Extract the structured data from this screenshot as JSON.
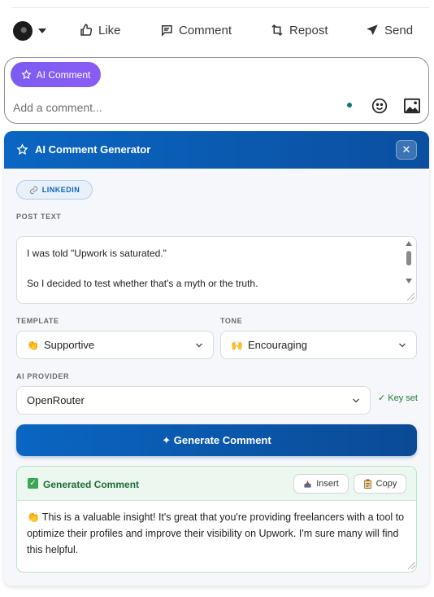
{
  "actions": {
    "like": "Like",
    "comment": "Comment",
    "repost": "Repost",
    "send": "Send"
  },
  "comment_box": {
    "ai_button": "AI Comment",
    "placeholder": "Add a comment..."
  },
  "panel": {
    "title": "AI Comment Generator",
    "close": "✕",
    "platform": "LINKEDIN",
    "post_text_label": "POST TEXT",
    "post_text_lines": [
      "I was told \"Upwork is saturated.\"",
      "So I decided to test whether that's a myth or the truth."
    ],
    "template_label": "TEMPLATE",
    "template_emoji": "👏",
    "template_value": "Supportive",
    "tone_label": "TONE",
    "tone_emoji": "🙌",
    "tone_value": "Encouraging",
    "provider_label": "AI PROVIDER",
    "provider_value": "OpenRouter",
    "key_status": "✓ Key set",
    "generate": "✦ Generate Comment"
  },
  "result": {
    "title": "Generated Comment",
    "insert": "Insert",
    "copy": "Copy",
    "text": "👏 This is a valuable insight! It's great that you're providing freelancers with a tool to optimize their profiles and improve their visibility on Upwork. I'm sure many will find this helpful."
  },
  "colors": {
    "linkedin_blue": "#0a66c2",
    "ai_purple": "#7b5cf0",
    "success_green": "#1f6b36"
  }
}
